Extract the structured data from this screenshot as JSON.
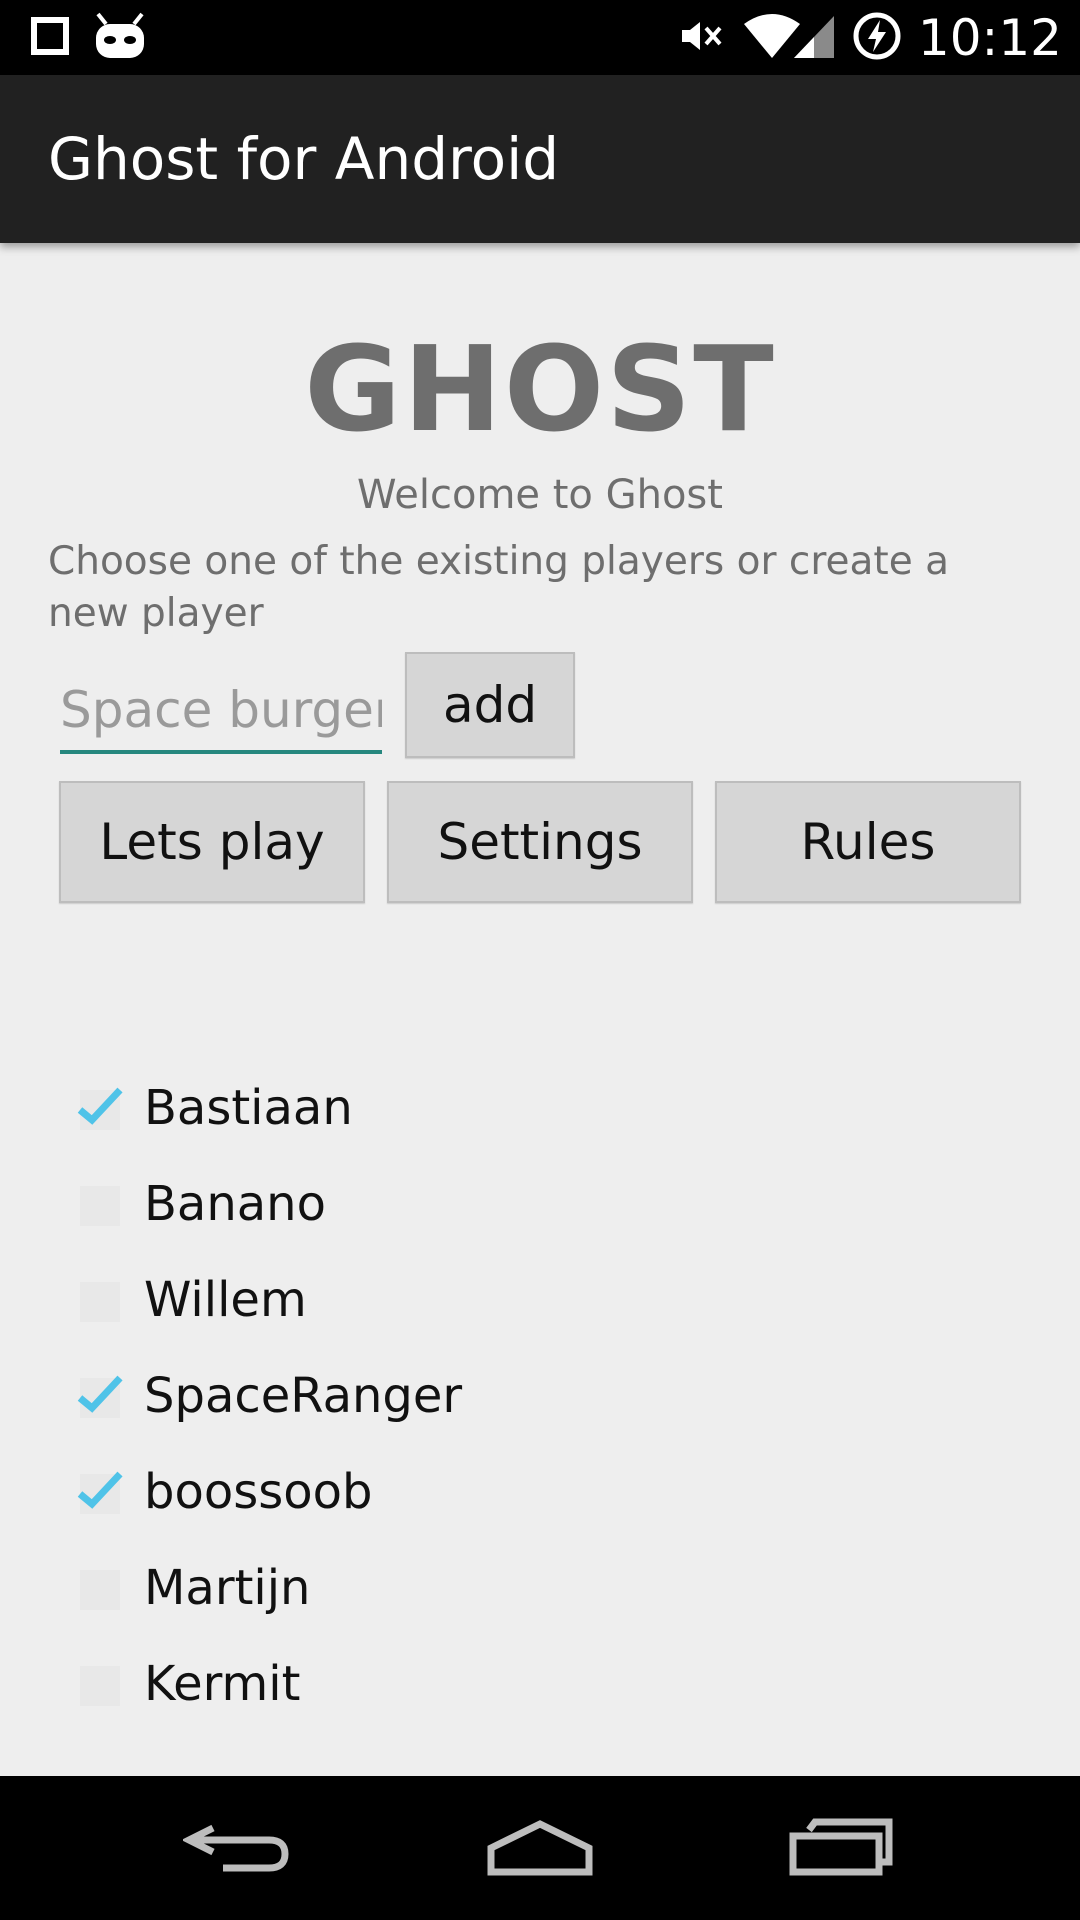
{
  "status_bar": {
    "time": "10:12",
    "icons": [
      "notification-square-icon",
      "android-robot-icon",
      "mute-icon",
      "wifi-icon",
      "signal-icon",
      "battery-charging-icon"
    ]
  },
  "app_bar": {
    "title": "Ghost for Android"
  },
  "main": {
    "heading": "GHOST",
    "welcome": "Welcome to Ghost",
    "instructions": "Choose one of the existing players or create a new player",
    "input_placeholder": "Space burger",
    "add_label": "add",
    "lets_play_label": "Lets play",
    "settings_label": "Settings",
    "rules_label": "Rules"
  },
  "players": [
    {
      "name": "Bastiaan",
      "checked": true
    },
    {
      "name": "Banano",
      "checked": false
    },
    {
      "name": "Willem",
      "checked": false
    },
    {
      "name": "SpaceRanger",
      "checked": true
    },
    {
      "name": "boossoob",
      "checked": true
    },
    {
      "name": "Martijn",
      "checked": false
    },
    {
      "name": "Kermit",
      "checked": false
    }
  ],
  "colors": {
    "check": "#4fc3e8",
    "accent_underline": "#26877e",
    "app_bar": "#212121",
    "background": "#eeeeee"
  },
  "nav_bar": {
    "icons": [
      "back-icon",
      "home-icon",
      "recents-icon"
    ]
  }
}
